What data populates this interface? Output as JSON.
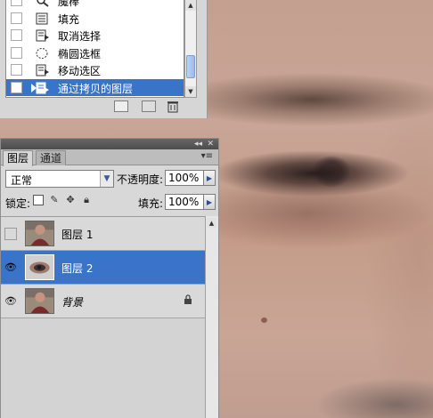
{
  "actions": {
    "items": [
      {
        "label": "魔棒",
        "icon": "magic-wand-icon"
      },
      {
        "label": "填充",
        "icon": "fill-icon"
      },
      {
        "label": "取消选择",
        "icon": "step-icon"
      },
      {
        "label": "椭圆选框",
        "icon": "elliptical-marquee-icon"
      },
      {
        "label": "移动选区",
        "icon": "step-icon"
      },
      {
        "label": "通过拷贝的图层",
        "icon": "step-icon",
        "selected": true
      }
    ],
    "footer_icons": [
      "new-snapshot-icon",
      "camera-icon",
      "trash-icon"
    ]
  },
  "layers_panel": {
    "tabs": [
      {
        "label": "图层",
        "active": true
      },
      {
        "label": "通道",
        "active": false
      }
    ],
    "blend_mode": "正常",
    "opacity_label": "不透明度:",
    "opacity_value": "100%",
    "lock_label": "锁定:",
    "fill_label": "填充:",
    "fill_value": "100%",
    "collapse_glyph": "◂◂",
    "close_glyph": "✕",
    "menu_glyph": "▾≡",
    "layers": [
      {
        "name": "图层 1",
        "visible": false,
        "selected": false,
        "locked": false
      },
      {
        "name": "图层 2",
        "visible": true,
        "selected": true,
        "locked": false
      },
      {
        "name": "背景",
        "visible": true,
        "selected": false,
        "locked": true,
        "italic": true
      }
    ]
  },
  "colors": {
    "selection": "#3a74c8",
    "panel_bg": "#d8d8d8",
    "skin_tone": "#c9a793"
  }
}
